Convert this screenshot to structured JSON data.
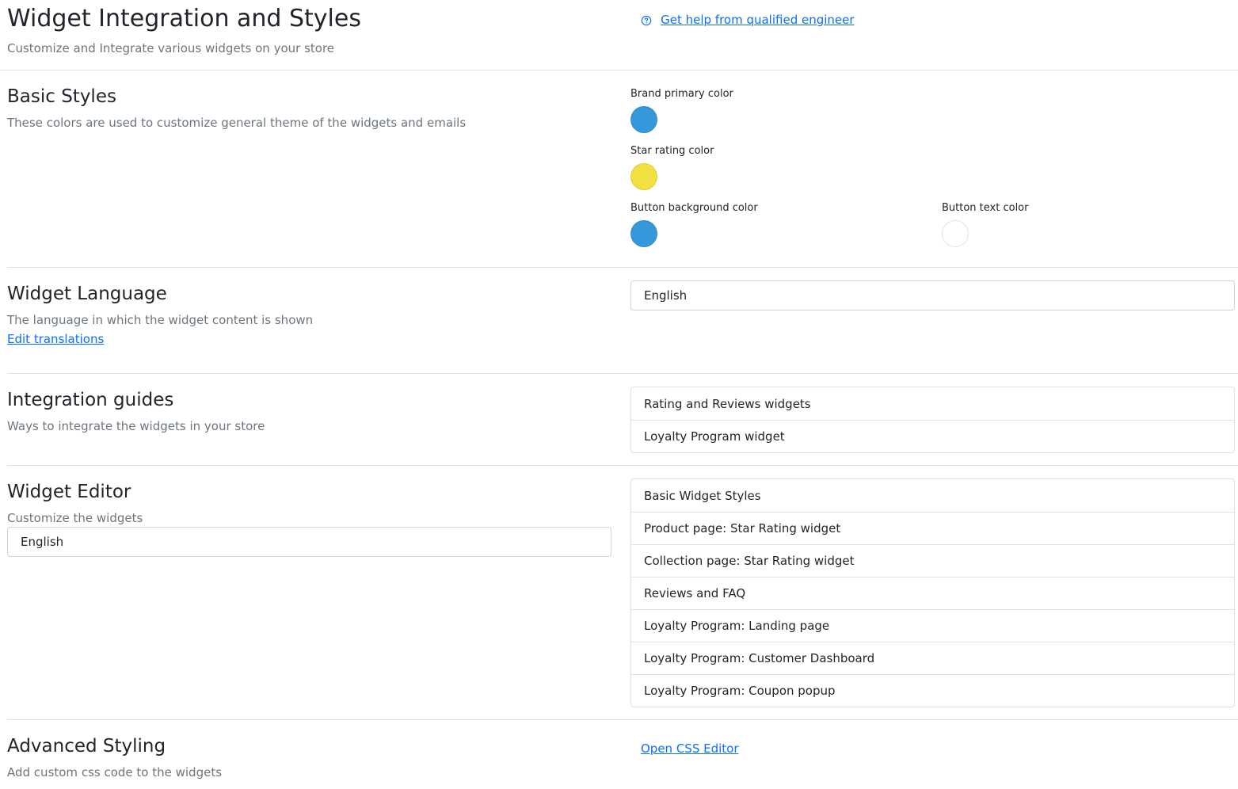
{
  "header": {
    "title": "Widget Integration and Styles",
    "subtitle": "Customize and Integrate various widgets on your store",
    "help_link": "Get help from qualified engineer",
    "help_icon": "question-circle-icon"
  },
  "basic_styles": {
    "title": "Basic Styles",
    "description": "These colors are used to customize general theme of the widgets and emails",
    "brand_primary": {
      "label": "Brand primary color",
      "color": "#3498db"
    },
    "star_rating": {
      "label": "Star rating color",
      "color": "#f0e040"
    },
    "button_bg": {
      "label": "Button background color",
      "color": "#3498db"
    },
    "button_text": {
      "label": "Button text color",
      "color": "#ffffff"
    }
  },
  "widget_language": {
    "title": "Widget Language",
    "description": "The language in which the widget content is shown",
    "edit_link": "Edit translations",
    "selected": "English"
  },
  "integration_guides": {
    "title": "Integration guides",
    "description": "Ways to integrate the widgets in your store",
    "items": [
      "Rating and Reviews widgets",
      "Loyalty Program widget"
    ]
  },
  "widget_editor": {
    "title": "Widget Editor",
    "description": "Customize the widgets",
    "language": "English",
    "items": [
      "Basic Widget Styles",
      "Product page: Star Rating widget",
      "Collection page: Star Rating widget",
      "Reviews and FAQ",
      "Loyalty Program: Landing page",
      "Loyalty Program: Customer Dashboard",
      "Loyalty Program: Coupon popup"
    ]
  },
  "advanced_styling": {
    "title": "Advanced Styling",
    "description": "Add custom css code to the widgets",
    "css_link": "Open CSS Editor"
  }
}
